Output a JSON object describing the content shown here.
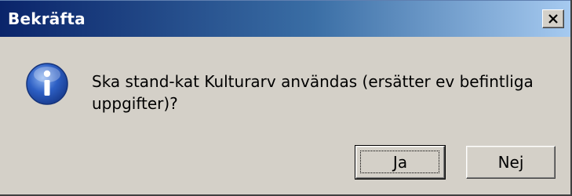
{
  "window": {
    "title": "Bekräfta",
    "close_icon": "close-icon"
  },
  "message": {
    "icon": "info-icon",
    "text": "Ska stand-kat Kulturarv användas (ersätter ev befintliga uppgifter)?"
  },
  "buttons": {
    "yes_label": "Ja",
    "no_label": "Nej"
  },
  "colors": {
    "titlebar_start": "#0a246a",
    "titlebar_end": "#a6caf0",
    "dialog_face": "#d4d0c8",
    "icon_blue": "#2d5fc4"
  }
}
